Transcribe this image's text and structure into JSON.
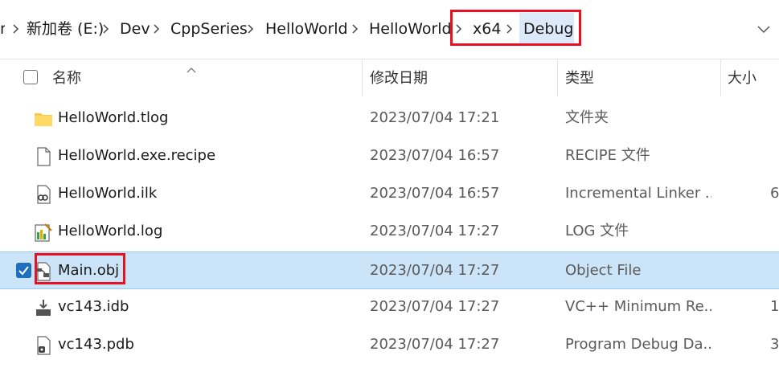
{
  "breadcrumb": {
    "cut_char": "n",
    "items": [
      "新加卷 (E:)",
      "Dev",
      "CppSeries",
      "HelloWorld",
      "HelloWorld",
      "x64",
      "Debug"
    ]
  },
  "columns": {
    "name": "名称",
    "date": "修改日期",
    "type": "类型",
    "size": "大小"
  },
  "files": [
    {
      "name": "HelloWorld.tlog",
      "date": "2023/07/04 17:21",
      "type": "文件夹",
      "size": "",
      "icon": "folder-icon",
      "selected": false
    },
    {
      "name": "HelloWorld.exe.recipe",
      "date": "2023/07/04 16:57",
      "type": "RECIPE 文件",
      "size": "",
      "icon": "file-icon",
      "selected": false
    },
    {
      "name": "HelloWorld.ilk",
      "date": "2023/07/04 16:57",
      "type": "Incremental Linker ...",
      "size": "6",
      "icon": "linker-file-icon",
      "selected": false
    },
    {
      "name": "HelloWorld.log",
      "date": "2023/07/04 17:27",
      "type": "LOG 文件",
      "size": "",
      "icon": "log-file-icon",
      "selected": false
    },
    {
      "name": "Main.obj",
      "date": "2023/07/04 17:27",
      "type": "Object File",
      "size": "",
      "icon": "object-file-icon",
      "selected": true
    },
    {
      "name": "vc143.idb",
      "date": "2023/07/04 17:27",
      "type": "VC++ Minimum Re...",
      "size": "1",
      "icon": "idb-file-icon",
      "selected": false
    },
    {
      "name": "vc143.pdb",
      "date": "2023/07/04 17:27",
      "type": "Program Debug Da...",
      "size": "3",
      "icon": "pdb-file-icon",
      "selected": false
    }
  ],
  "colors": {
    "selection": "#cce4f7",
    "highlight_box": "#e81123",
    "checkbox": "#1f6fbf"
  }
}
